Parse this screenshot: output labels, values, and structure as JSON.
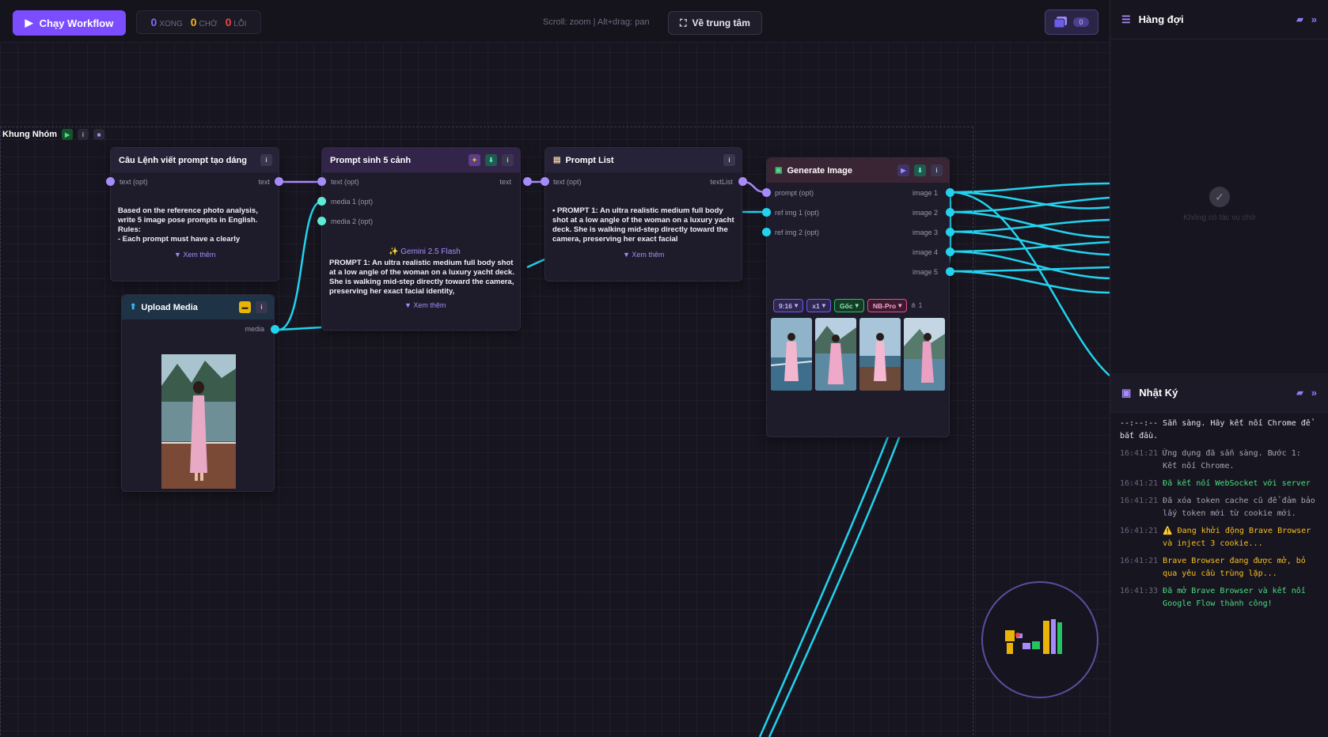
{
  "toolbar": {
    "run_label": "Chạy Workflow",
    "stats": [
      {
        "value": "0",
        "label": "XONG",
        "color": "#7c6cf6"
      },
      {
        "value": "0",
        "label": "CHỜ",
        "color": "#f5b21b"
      },
      {
        "value": "0",
        "label": "LỖI",
        "color": "#ef4444"
      }
    ],
    "hint": "Scroll: zoom | Alt+drag: pan",
    "center_label": "Về trung tâm",
    "gallery_count": "0"
  },
  "group": {
    "label": "Khung Nhóm"
  },
  "nodes": {
    "prompt_writer": {
      "title": "Câu Lệnh viết prompt tạo dáng",
      "in_label": "text (opt)",
      "out_label": "text",
      "body": "Based on the reference photo analysis, write 5 image pose prompts in English.\nRules:\n- Each prompt must have a clearly",
      "more": "▼ Xem thêm"
    },
    "scene_prompt": {
      "title": "Prompt sinh 5 cảnh",
      "inputs": [
        "text (opt)",
        "media 1 (opt)",
        "media 2 (opt)"
      ],
      "out_label": "text",
      "model": "✨ Gemini 2.5 Flash",
      "body": "PROMPT 1: An ultra realistic medium full body shot at a low angle of the woman on a luxury yacht deck. She is walking mid-step directly toward the camera, preserving her exact facial identity,",
      "more": "▼ Xem thêm"
    },
    "prompt_list": {
      "title": "Prompt List",
      "in_label": "text (opt)",
      "out_label": "textList",
      "body": "• PROMPT 1: An ultra realistic medium full body shot at a low angle of the woman on a luxury yacht deck. She is walking mid-step directly toward the camera, preserving her exact facial",
      "more": "▼ Xem thêm"
    },
    "upload_media": {
      "title": "Upload Media",
      "out_label": "media"
    },
    "generate_image": {
      "title": "Generate Image",
      "inputs": [
        "prompt (opt)",
        "ref img 1 (opt)",
        "ref img 2 (opt)"
      ],
      "outputs": [
        "image 1",
        "image 2",
        "image 3",
        "image 4",
        "image 5"
      ],
      "chips": [
        "9:16",
        "x1",
        "Gốc",
        "NB-Pro"
      ],
      "chip_colors": [
        "#6d5cf0",
        "#6d5cf0",
        "#22c55e",
        "#ec4899"
      ],
      "count_label": "1"
    }
  },
  "queue": {
    "title": "Hàng đợi",
    "empty": "Không có tác vụ chờ"
  },
  "log": {
    "title": "Nhật Ký",
    "entries": [
      {
        "time": "--:--:--",
        "text": "Sẵn sàng. Hãy kết nối Chrome để bắt đầu.",
        "color": "#e6e4ee"
      },
      {
        "time": "16:41:21",
        "text": "Ứng dụng đã sẵn sàng. Bước 1: Kết nối Chrome.",
        "color": "#a9a4b8"
      },
      {
        "time": "16:41:21",
        "text": "Đã kết nối WebSocket với server",
        "color": "#4ade80"
      },
      {
        "time": "16:41:21",
        "text": "Đã xóa token cache cũ để đảm bảo lấy token mới từ cookie mới.",
        "color": "#a9a4b8"
      },
      {
        "time": "16:41:21",
        "text": "⚠️ Đang khởi động Brave Browser và inject 3 cookie...",
        "color": "#fbbf24"
      },
      {
        "time": "16:41:21",
        "text": "Brave Browser đang được mở, bỏ qua yêu cầu trùng lặp...",
        "color": "#fbbf24"
      },
      {
        "time": "16:41:33",
        "text": "Đã mở Brave Browser và kết nối Google Flow thành công!",
        "color": "#4ade80"
      }
    ]
  }
}
